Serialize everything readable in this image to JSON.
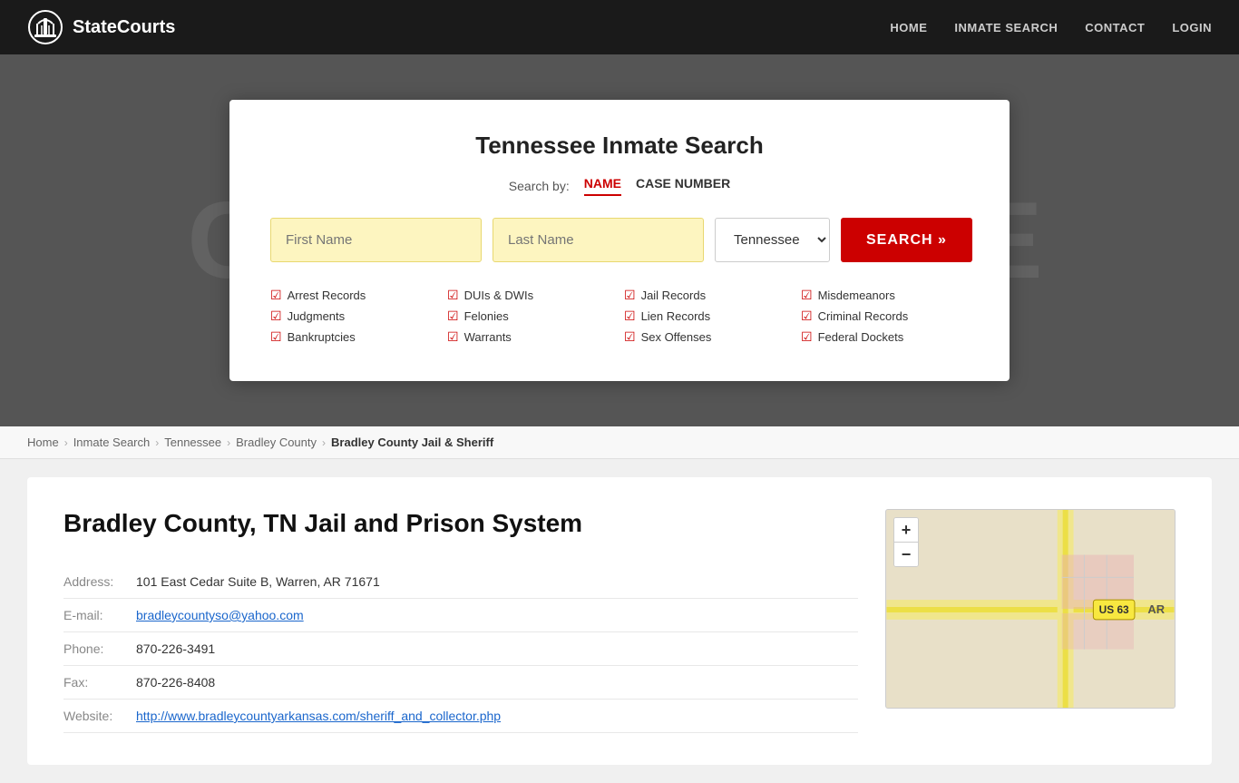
{
  "header": {
    "logo_text": "StateCourts",
    "nav": [
      {
        "label": "HOME",
        "id": "home"
      },
      {
        "label": "INMATE SEARCH",
        "id": "inmate-search"
      },
      {
        "label": "CONTACT",
        "id": "contact"
      },
      {
        "label": "LOGIN",
        "id": "login"
      }
    ]
  },
  "hero": {
    "bg_text": "COURTHOUSE"
  },
  "search_card": {
    "title": "Tennessee Inmate Search",
    "search_by_label": "Search by:",
    "tabs": [
      {
        "label": "NAME",
        "active": true
      },
      {
        "label": "CASE NUMBER",
        "active": false
      }
    ],
    "fields": {
      "first_name_placeholder": "First Name",
      "last_name_placeholder": "Last Name",
      "state_value": "Tennessee",
      "search_button": "SEARCH »"
    },
    "checks": [
      "Arrest Records",
      "DUIs & DWIs",
      "Jail Records",
      "Misdemeanors",
      "Judgments",
      "Felonies",
      "Lien Records",
      "Criminal Records",
      "Bankruptcies",
      "Warrants",
      "Sex Offenses",
      "Federal Dockets"
    ]
  },
  "breadcrumb": {
    "items": [
      {
        "label": "Home",
        "link": true
      },
      {
        "label": "Inmate Search",
        "link": true
      },
      {
        "label": "Tennessee",
        "link": true
      },
      {
        "label": "Bradley County",
        "link": true
      },
      {
        "label": "Bradley County Jail & Sheriff",
        "link": false
      }
    ]
  },
  "detail": {
    "title": "Bradley County, TN Jail and Prison System",
    "address_label": "Address:",
    "address_value": "101 East Cedar Suite B, Warren, AR 71671",
    "email_label": "E-mail:",
    "email_value": "bradleycountyso@yahoo.com",
    "phone_label": "Phone:",
    "phone_value": "870-226-3491",
    "fax_label": "Fax:",
    "fax_value": "870-226-8408",
    "website_label": "Website:",
    "website_value": "http://www.bradleycountyarkansas.com/sheriff_and_collector.php"
  },
  "map": {
    "zoom_in": "+",
    "zoom_out": "−",
    "label": "US 63"
  }
}
